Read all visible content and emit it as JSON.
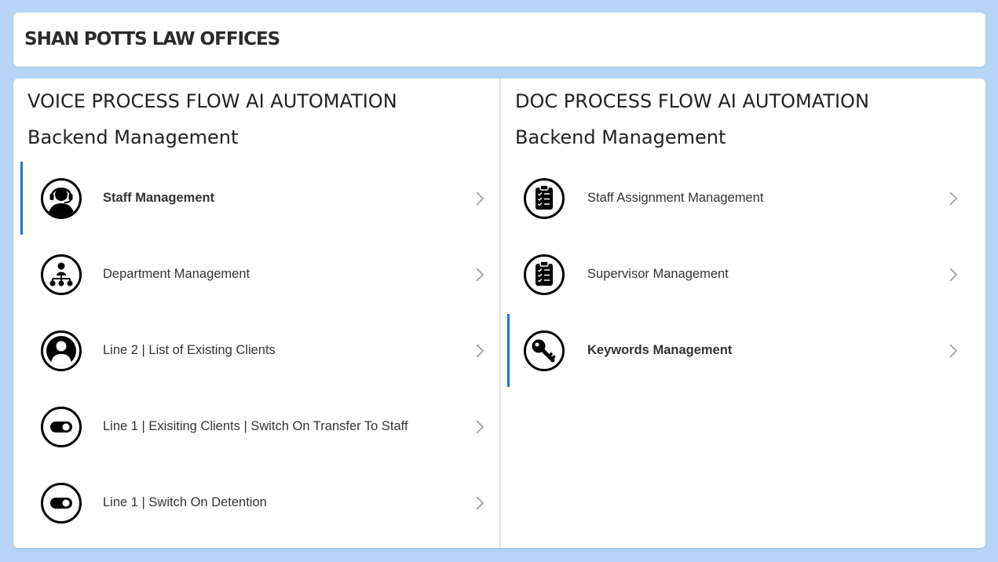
{
  "header": {
    "brand": "SHAN POTTS LAW OFFICES"
  },
  "voice": {
    "title": "VOICE PROCESS FLOW AI AUTOMATION",
    "subtitle": "Backend Management",
    "items": [
      {
        "label": "Staff Management",
        "icon": "headset-user-icon",
        "active": true
      },
      {
        "label": "Department Management",
        "icon": "org-chart-icon",
        "active": false
      },
      {
        "label": "Line 2 | List of Existing Clients",
        "icon": "user-circle-icon",
        "active": false
      },
      {
        "label": "Line 1 | Exisiting Clients | Switch On Transfer To Staff",
        "icon": "toggle-icon",
        "active": false
      },
      {
        "label": "Line 1 | Switch On Detention",
        "icon": "toggle-icon",
        "active": false
      }
    ]
  },
  "doc": {
    "title": "DOC PROCESS FLOW AI AUTOMATION",
    "subtitle": "Backend Management",
    "items": [
      {
        "label": "Staff Assignment Management",
        "icon": "clipboard-checklist-icon",
        "active": false
      },
      {
        "label": "Supervisor Management",
        "icon": "clipboard-checklist-icon",
        "active": false
      },
      {
        "label": "Keywords Management",
        "icon": "key-icon",
        "active": true
      }
    ]
  },
  "colors": {
    "background": "#b7d6f7",
    "accent": "#1e73c8",
    "text": "#333333"
  }
}
